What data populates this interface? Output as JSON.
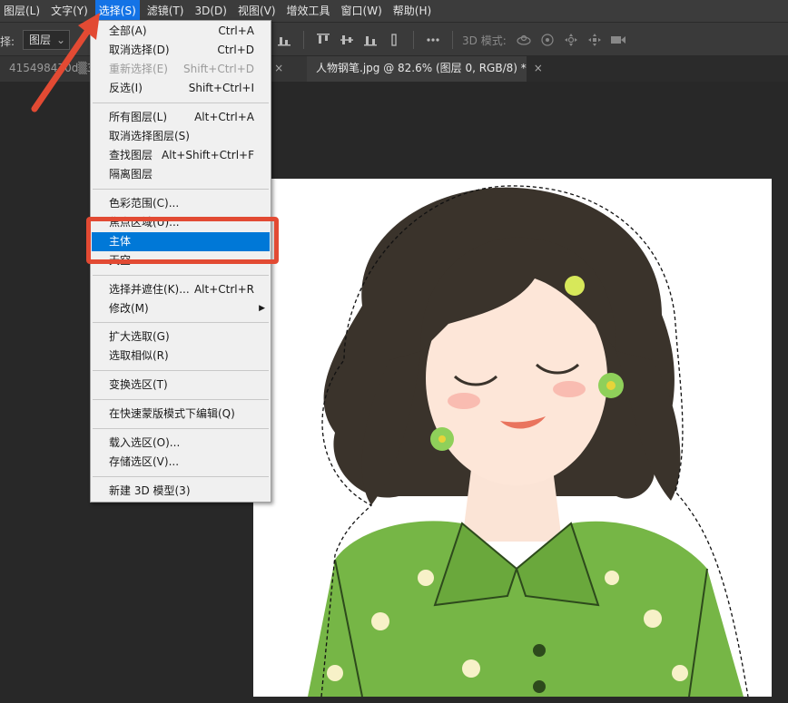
{
  "menubar": {
    "items": [
      "图层(L)",
      "文字(Y)",
      "选择(S)",
      "滤镜(T)",
      "3D(D)",
      "视图(V)",
      "增效工具",
      "窗口(W)",
      "帮助(H)"
    ]
  },
  "options": {
    "label": "择:",
    "select_value": "图层",
    "mode_label": "3D 模式:"
  },
  "tabs": {
    "inactive_title": "415498470d▒35c6...@ 82.6% (图层 0, RGB/8) *",
    "active_title": "人物钢笔.jpg @ 82.6% (图层 0, RGB/8) *",
    "close_glyph": "×"
  },
  "menu": {
    "items": [
      {
        "label": "全部(A)",
        "shortcut": "Ctrl+A",
        "disabled": false
      },
      {
        "label": "取消选择(D)",
        "shortcut": "Ctrl+D",
        "disabled": false
      },
      {
        "label": "重新选择(E)",
        "shortcut": "Shift+Ctrl+D",
        "disabled": true
      },
      {
        "label": "反选(I)",
        "shortcut": "Shift+Ctrl+I",
        "disabled": false
      },
      {
        "label": "所有图层(L)",
        "shortcut": "Alt+Ctrl+A",
        "disabled": false
      },
      {
        "label": "取消选择图层(S)",
        "shortcut": "",
        "disabled": false
      },
      {
        "label": "查找图层",
        "shortcut": "Alt+Shift+Ctrl+F",
        "disabled": false
      },
      {
        "label": "隔离图层",
        "shortcut": "",
        "disabled": false
      },
      {
        "label": "色彩范围(C)...",
        "shortcut": "",
        "disabled": false
      },
      {
        "label": "焦点区域(U)...",
        "shortcut": "",
        "disabled": false
      },
      {
        "label": "主体",
        "shortcut": "",
        "disabled": false
      },
      {
        "label": "天空",
        "shortcut": "",
        "disabled": false
      },
      {
        "label": "选择并遮住(K)...",
        "shortcut": "Alt+Ctrl+R",
        "disabled": false
      },
      {
        "label": "修改(M)",
        "shortcut": "",
        "disabled": false
      },
      {
        "label": "扩大选取(G)",
        "shortcut": "",
        "disabled": false
      },
      {
        "label": "选取相似(R)",
        "shortcut": "",
        "disabled": false
      },
      {
        "label": "变换选区(T)",
        "shortcut": "",
        "disabled": false
      },
      {
        "label": "在快速蒙版模式下编辑(Q)",
        "shortcut": "",
        "disabled": false
      },
      {
        "label": "载入选区(O)...",
        "shortcut": "",
        "disabled": false
      },
      {
        "label": "存储选区(V)...",
        "shortcut": "",
        "disabled": false
      },
      {
        "label": "新建 3D 模型(3)",
        "shortcut": "",
        "disabled": false
      }
    ],
    "submenu_glyph": "▶"
  },
  "colors": {
    "annotation": "#e24a33",
    "menu_highlight": "#0078d7",
    "active_menu": "#1473e6"
  }
}
